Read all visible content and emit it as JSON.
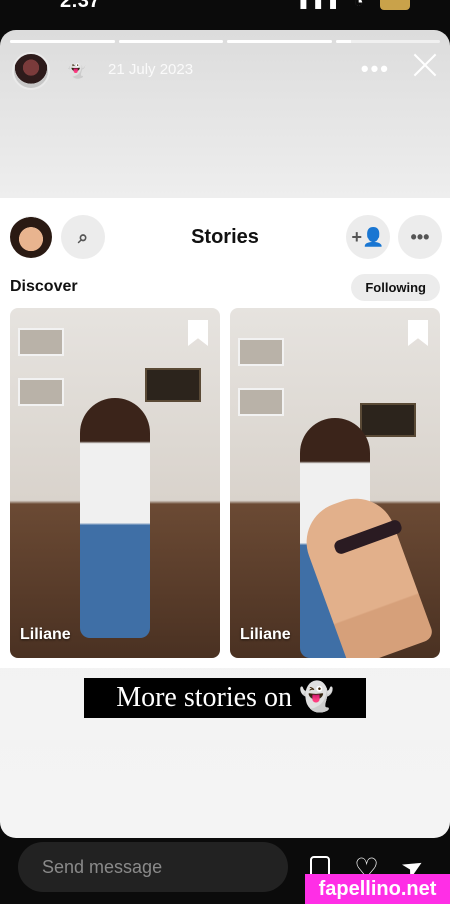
{
  "status_bar": {
    "time": "2:37",
    "signal_icon": "signal-icon",
    "wifi_icon": "wifi-icon",
    "battery_icon": "battery-icon",
    "battery_color": "#c9a24a"
  },
  "story_progress": [
    1.0,
    1.0,
    1.0,
    0.15
  ],
  "story_header": {
    "date": "21 July 2023",
    "avatar_icon": "user-avatar",
    "ghost_icon": "ghost-icon"
  },
  "embedded_screen": {
    "title": "Stories",
    "discover_label": "Discover",
    "following_label": "Following",
    "icons": {
      "search": "search-icon",
      "add_friend": "add-friend-icon",
      "more": "more-icon"
    },
    "tiles": [
      {
        "name": "Liliane",
        "bookmark_icon": "bookmark-icon"
      },
      {
        "name": "Liliane",
        "bookmark_icon": "bookmark-icon"
      }
    ]
  },
  "caption": "More stories on 👻",
  "bottom_bar": {
    "placeholder": "Send message",
    "icons": {
      "reply": "reply-icon",
      "like": "heart-icon",
      "share": "send-icon"
    }
  },
  "watermark": "fapellino.net",
  "colors": {
    "watermark_bg": "#ff2ee6",
    "background": "#0b0b0b"
  }
}
